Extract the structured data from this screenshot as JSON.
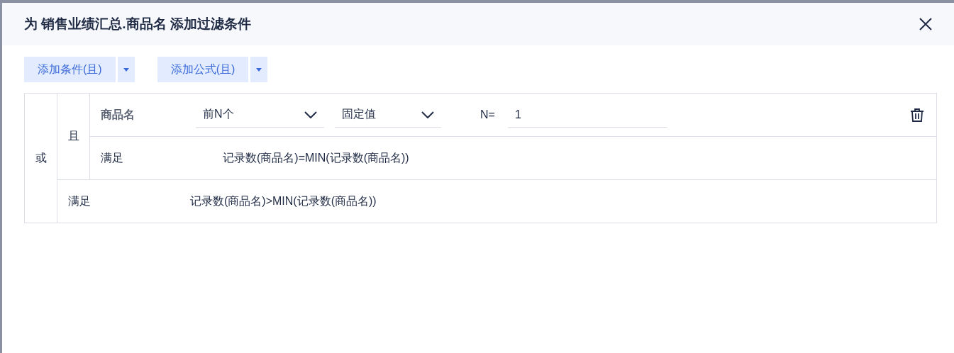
{
  "dialog": {
    "title": "为 销售业绩汇总.商品名 添加过滤条件"
  },
  "toolbar": [
    {
      "label": "添加条件(且)"
    },
    {
      "label": "添加公式(且)"
    }
  ],
  "filter": {
    "operator": "或",
    "items": [
      {
        "kind": "group",
        "operator": "且",
        "items": [
          {
            "kind": "condition",
            "field": "商品名",
            "selects": [
              "前N个",
              "固定值"
            ],
            "n_label": "N=",
            "n_value": "1"
          },
          {
            "kind": "formula",
            "label": "满足",
            "formula": "记录数(商品名)=MIN(记录数(商品名))"
          }
        ]
      },
      {
        "kind": "formula",
        "label": "满足",
        "formula": "记录数(商品名)>MIN(记录数(商品名))"
      }
    ]
  }
}
